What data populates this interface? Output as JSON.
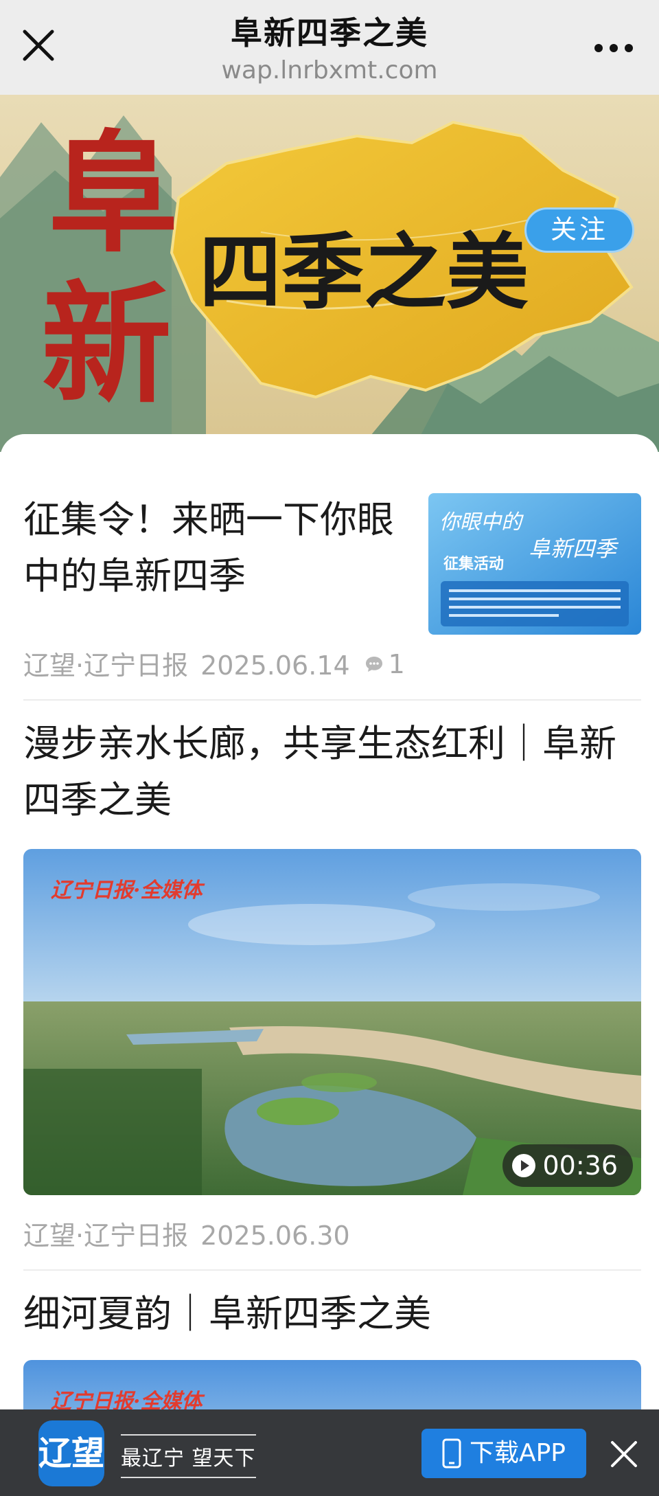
{
  "header": {
    "title": "阜新四季之美",
    "url": "wap.lnrbxmt.com"
  },
  "banner": {
    "title_vertical": "阜新",
    "title_horizontal": "四季之美",
    "follow_label": "关注"
  },
  "articles": [
    {
      "title": "征集令！来晒一下你眼中的阜新四季",
      "source": "辽望·辽宁日报",
      "date": "2025.06.14",
      "comments": "1",
      "thumb": {
        "heading": "你眼中的",
        "subheading": "阜新四季",
        "tag": "征集活动"
      }
    },
    {
      "title": "漫步亲水长廊，共享生态红利｜阜新四季之美",
      "source": "辽望·辽宁日报",
      "date": "2025.06.30",
      "video_watermark": "辽宁日报·全媒体",
      "duration": "00:36"
    },
    {
      "title": "细河夏韵｜阜新四季之美",
      "video_watermark": "辽宁日报·全媒体"
    }
  ],
  "bottom_bar": {
    "logo_text": "辽望",
    "slogan": "最辽宁 望天下",
    "download_label": "下载APP"
  }
}
